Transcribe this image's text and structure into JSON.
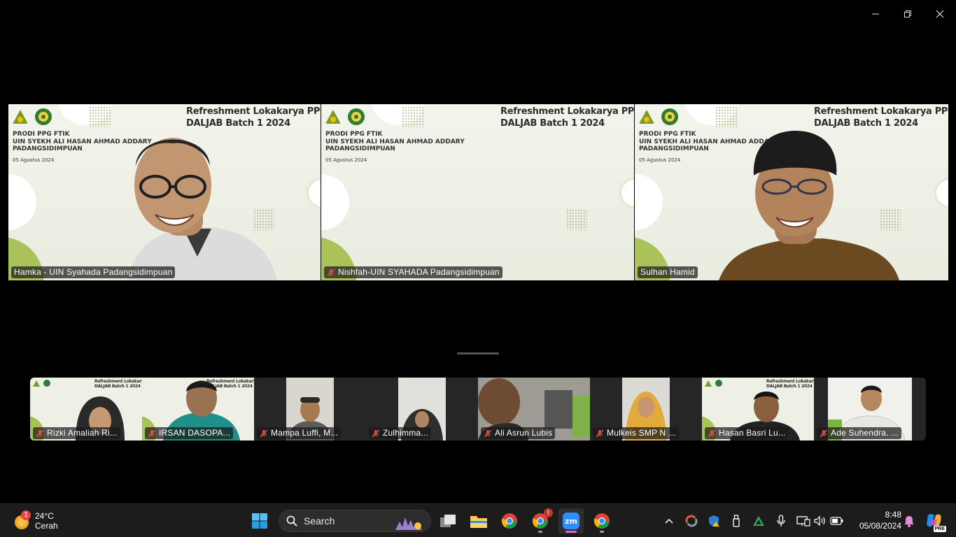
{
  "window": {
    "controls": [
      "minimize-icon",
      "restore-icon",
      "close-icon"
    ]
  },
  "slide": {
    "title_line1": "Refreshment Lokakarya PPG PAI",
    "title_line2": "DALJAB Batch 1 2024",
    "org_line1": "PRODI PPG FTIK",
    "org_line2": "UIN SYEKH ALI HASAN AHMAD ADDARY",
    "org_line3": "PADANGSIDIMPUAN",
    "date": "05 Agustus 2024"
  },
  "main_tiles": [
    {
      "name": "Hamka - UIN Syahada Padangsidimpuan",
      "muted": false,
      "speaking": false
    },
    {
      "name": "Nishfah-UIN SYAHADA Padangsidimpuan",
      "muted": true,
      "speaking": false
    },
    {
      "name": "Sulhan Hamid",
      "muted": false,
      "speaking": true
    }
  ],
  "thumbnails": [
    {
      "name": "Rizki Amaliah Ri...",
      "muted": true
    },
    {
      "name": "IRSAN DASOPA...",
      "muted": true
    },
    {
      "name": "Mampa Luffi, M...",
      "muted": true
    },
    {
      "name": "Zulhimma...",
      "muted": true
    },
    {
      "name": "Ali Asrun Lubis",
      "muted": true
    },
    {
      "name": "Mulkeis SMP N ...",
      "muted": true
    },
    {
      "name": "Hasan Basri  Lu...",
      "muted": true
    },
    {
      "name": "Ade Suhendra. ...",
      "muted": true
    }
  ],
  "taskbar": {
    "weather": {
      "temp": "24°C",
      "condition": "Cerah",
      "badge": "1"
    },
    "search_label": "Search",
    "chrome_badge": "!",
    "clock": {
      "time": "8:48",
      "date": "05/08/2024"
    },
    "copilot_badge": "PRE",
    "colors": {
      "accent": "#d86ad8",
      "speaking": "#23d18b",
      "taskbar": "#1c1c1c"
    }
  }
}
